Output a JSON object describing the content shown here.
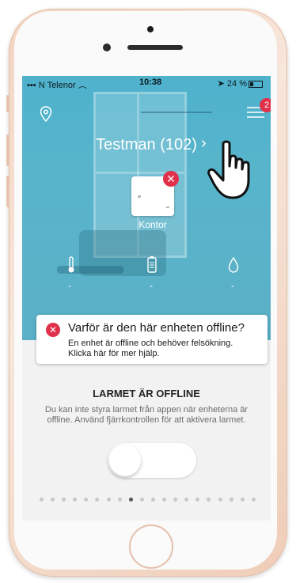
{
  "status_bar": {
    "carrier": "N Telenor",
    "time": "10:38",
    "battery": "24 %"
  },
  "header": {
    "badge_count": "2",
    "title": "Testman (102)",
    "chevron": "›"
  },
  "device": {
    "label": "Kontor"
  },
  "sensors": [
    {
      "icon": "thermometer-icon",
      "value": "-"
    },
    {
      "icon": "battery-icon",
      "value": "-"
    },
    {
      "icon": "humidity-drop-icon",
      "value": "-"
    }
  ],
  "tooltip": {
    "title": "Varför är den här enheten offline?",
    "body_line1": "En enhet är offline och behöver felsökning.",
    "body_line2": "Klicka här för mer hjälp."
  },
  "alarm": {
    "heading": "LARMET ÄR OFFLINE",
    "description": "Du kan inte styra larmet från appen när enheterna är offline. Använd fjärrkontrollen för att aktivera larmet."
  },
  "pager": {
    "count": 20,
    "active_index": 8
  },
  "colors": {
    "accent_red": "#e0304a",
    "hero_blue": "#58b4cb"
  }
}
